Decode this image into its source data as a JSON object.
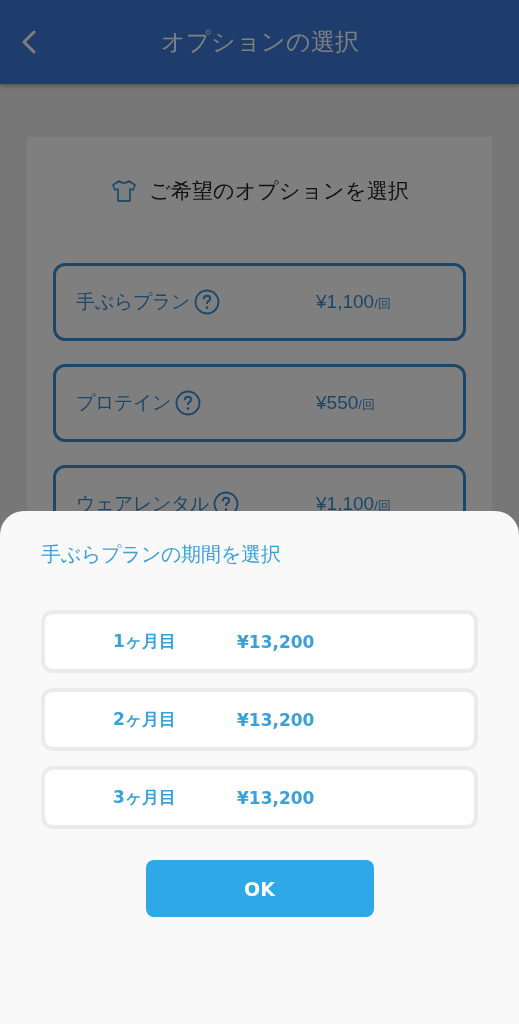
{
  "header": {
    "title": "オプションの選択"
  },
  "card": {
    "title": "ご希望のオプションを選択",
    "options": [
      {
        "name": "手ぶらプラン",
        "price": "¥1,100",
        "unit": "/回"
      },
      {
        "name": "プロテイン",
        "price": "¥550",
        "unit": "/回"
      },
      {
        "name": "ウェアレンタル",
        "price": "¥1,100",
        "unit": "/回"
      }
    ]
  },
  "sheet": {
    "title": "手ぶらプランの期間を選択",
    "periods": [
      {
        "label": "1ヶ月目",
        "price": "¥13,200"
      },
      {
        "label": "2ヶ月目",
        "price": "¥13,200"
      },
      {
        "label": "3ヶ月目",
        "price": "¥13,200"
      }
    ],
    "button": "OK"
  }
}
